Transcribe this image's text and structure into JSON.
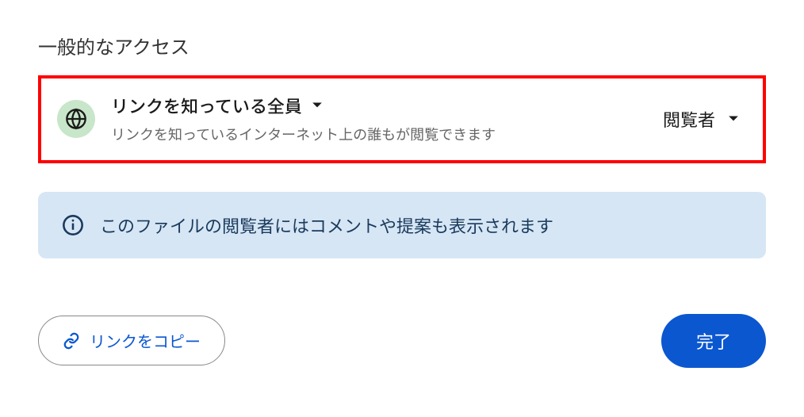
{
  "section_title": "一般的なアクセス",
  "access": {
    "scope_label": "リンクを知っている全員",
    "description": "リンクを知っているインターネット上の誰もが閲覧できます",
    "role_label": "閲覧者"
  },
  "info_message": "このファイルの閲覧者にはコメントや提案も表示されます",
  "footer": {
    "copy_link_label": "リンクをコピー",
    "done_label": "完了"
  },
  "colors": {
    "highlight_border": "#ff0000",
    "globe_bg": "#c8e6c9",
    "info_bg": "#d6e6f5",
    "primary": "#0b57d0"
  }
}
